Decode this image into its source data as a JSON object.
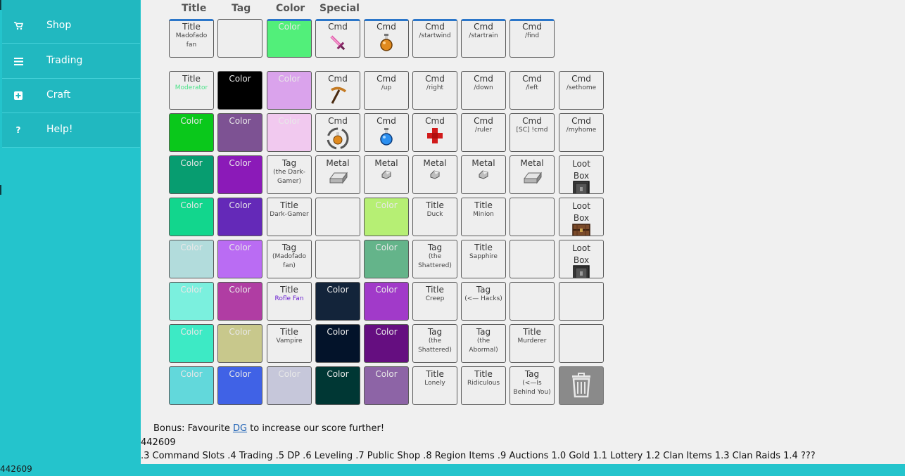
{
  "sidebar": {
    "items": [
      {
        "label": "Shop",
        "icon": "cart-icon"
      },
      {
        "label": "Trading",
        "icon": "list-icon"
      },
      {
        "label": "Craft",
        "icon": "plus-icon"
      },
      {
        "label": "Help!",
        "icon": "question-icon"
      }
    ]
  },
  "bottom_left_number": "442609",
  "headers": [
    "Title",
    "Tag",
    "Color",
    "Special"
  ],
  "colors": {
    "sidebar_bg": "#21b8c0",
    "page_bg": "#24c4cc",
    "panel_bg": "#f0f0f0",
    "slot_bg": "#eeeeee",
    "active_border": "#2b76c9"
  },
  "equipped": [
    {
      "t1": "Title",
      "t2": "Madofado fan"
    },
    {
      "t1": "",
      "t2": ""
    },
    {
      "t1": "Color",
      "t2": "",
      "color": "#52ef7a"
    },
    {
      "t1": "Cmd",
      "t2": "",
      "icon": "sword-icon"
    },
    {
      "t1": "Cmd",
      "t2": "",
      "icon": "orange-potion-icon"
    },
    {
      "t1": "Cmd",
      "t2": "/startwind"
    },
    {
      "t1": "Cmd",
      "t2": "/startrain"
    },
    {
      "t1": "Cmd",
      "t2": "/find"
    }
  ],
  "inventory": [
    [
      {
        "t1": "Title",
        "t2": "Moderator",
        "t2color": "#4ee38a"
      },
      {
        "t1": "Color",
        "t2": "",
        "color": "#000000"
      },
      {
        "t1": "Color",
        "t2": "",
        "color": "#daa3ec"
      },
      {
        "t1": "Cmd",
        "t2": "",
        "icon": "pickaxe-icon"
      },
      {
        "t1": "Cmd",
        "t2": "/up"
      },
      {
        "t1": "Cmd",
        "t2": "/right"
      },
      {
        "t1": "Cmd",
        "t2": "/down"
      },
      {
        "t1": "Cmd",
        "t2": "/left"
      },
      {
        "t1": "Cmd",
        "t2": "/sethome"
      }
    ],
    [
      {
        "t1": "Color",
        "t2": "",
        "color": "#0ac81b"
      },
      {
        "t1": "Color",
        "t2": "",
        "color": "#7d5293"
      },
      {
        "t1": "Color",
        "t2": "",
        "color": "#f1c9ef"
      },
      {
        "t1": "Cmd",
        "t2": "",
        "icon": "recycle-potion-icon"
      },
      {
        "t1": "Cmd",
        "t2": "",
        "icon": "blue-potion-icon"
      },
      {
        "t1": "Cmd",
        "t2": "",
        "icon": "red-cross-icon"
      },
      {
        "t1": "Cmd",
        "t2": "/ruler"
      },
      {
        "t1": "Cmd",
        "t2": "[SC] !cmd"
      },
      {
        "t1": "Cmd",
        "t2": "/myhome"
      }
    ],
    [
      {
        "t1": "Color",
        "t2": "",
        "color": "#079d70"
      },
      {
        "t1": "Color",
        "t2": "",
        "color": "#8b1ab8"
      },
      {
        "t1": "Tag",
        "t2": "(the Dark-Gamer)"
      },
      {
        "t1": "Metal",
        "t2": "",
        "icon": "ingot-icon"
      },
      {
        "t1": "Metal",
        "t2": "",
        "icon": "nugget-icon"
      },
      {
        "t1": "Metal",
        "t2": "",
        "icon": "nugget-icon"
      },
      {
        "t1": "Metal",
        "t2": "",
        "icon": "nugget-icon"
      },
      {
        "t1": "Metal",
        "t2": "",
        "icon": "ingot-icon"
      },
      {
        "t1": "Loot Box",
        "t2": "",
        "icon": "lootbox-dark-icon"
      }
    ],
    [
      {
        "t1": "Color",
        "t2": "",
        "color": "#12d68d"
      },
      {
        "t1": "Color",
        "t2": "",
        "color": "#6429b8"
      },
      {
        "t1": "Title",
        "t2": "Dark-Gamer"
      },
      {
        "t1": "",
        "t2": ""
      },
      {
        "t1": "Color",
        "t2": "",
        "color": "#b6ef74"
      },
      {
        "t1": "Title",
        "t2": "Duck"
      },
      {
        "t1": "Title",
        "t2": "Minion"
      },
      {
        "t1": "",
        "t2": ""
      },
      {
        "t1": "Loot Box",
        "t2": "",
        "icon": "lootbox-chest-icon"
      }
    ],
    [
      {
        "t1": "Color",
        "t2": "",
        "color": "#b2dcdc"
      },
      {
        "t1": "Color",
        "t2": "",
        "color": "#ba6cf3"
      },
      {
        "t1": "Tag",
        "t2": "(Madofado fan)"
      },
      {
        "t1": "",
        "t2": ""
      },
      {
        "t1": "Color",
        "t2": "",
        "color": "#64b48a"
      },
      {
        "t1": "Tag",
        "t2": "(the Shattered)"
      },
      {
        "t1": "Title",
        "t2": "Sapphire"
      },
      {
        "t1": "",
        "t2": ""
      },
      {
        "t1": "Loot Box",
        "t2": "",
        "icon": "lootbox-dark-icon"
      }
    ],
    [
      {
        "t1": "Color",
        "t2": "",
        "color": "#7bf0de"
      },
      {
        "t1": "Color",
        "t2": "",
        "color": "#b03da3"
      },
      {
        "t1": "Title",
        "t2": "Rofle Fan",
        "t2color": "#6a1fd0"
      },
      {
        "t1": "Color",
        "t2": "",
        "color": "#13243a"
      },
      {
        "t1": "Color",
        "t2": "",
        "color": "#a13ac9"
      },
      {
        "t1": "Title",
        "t2": "Creep"
      },
      {
        "t1": "Tag",
        "t2": "(<— Hacks)"
      },
      {
        "t1": "",
        "t2": ""
      },
      {
        "t1": "",
        "t2": ""
      }
    ],
    [
      {
        "t1": "Color",
        "t2": "",
        "color": "#3deac5"
      },
      {
        "t1": "Color",
        "t2": "",
        "color": "#c8c88c"
      },
      {
        "t1": "Title",
        "t2": "Vampire"
      },
      {
        "t1": "Color",
        "t2": "",
        "color": "#03132a"
      },
      {
        "t1": "Color",
        "t2": "",
        "color": "#650e80"
      },
      {
        "t1": "Tag",
        "t2": "(the Shattered)"
      },
      {
        "t1": "Tag",
        "t2": "(the Abormal)"
      },
      {
        "t1": "Title",
        "t2": "Murderer"
      },
      {
        "t1": "",
        "t2": ""
      }
    ],
    [
      {
        "t1": "Color",
        "t2": "",
        "color": "#62d8db"
      },
      {
        "t1": "Color",
        "t2": "",
        "color": "#4062e6"
      },
      {
        "t1": "Color",
        "t2": "",
        "color": "#c6c7da"
      },
      {
        "t1": "Color",
        "t2": "",
        "color": "#003734"
      },
      {
        "t1": "Color",
        "t2": "",
        "color": "#8d64a6"
      },
      {
        "t1": "Title",
        "t2": "Lonely"
      },
      {
        "t1": "Title",
        "t2": "Ridiculous"
      },
      {
        "t1": "Tag",
        "t2": "(<—Is Behind You)"
      },
      {
        "t1": "",
        "t2": "",
        "icon": "trash-icon",
        "trash": true
      }
    ]
  ],
  "footer": {
    "bonus_before": "Bonus: Favourite ",
    "bonus_link": "DG",
    "bonus_after": " to increase our score further!",
    "number": "442609",
    "roadmap": ".3 Command Slots .4 Trading .5 DP .6 Leveling .7 Public Shop .8 Region Items .9 Auctions 1.0 Gold 1.1 Lottery 1.2 Clan Items 1.3 Clan Raids 1.4 ???"
  }
}
